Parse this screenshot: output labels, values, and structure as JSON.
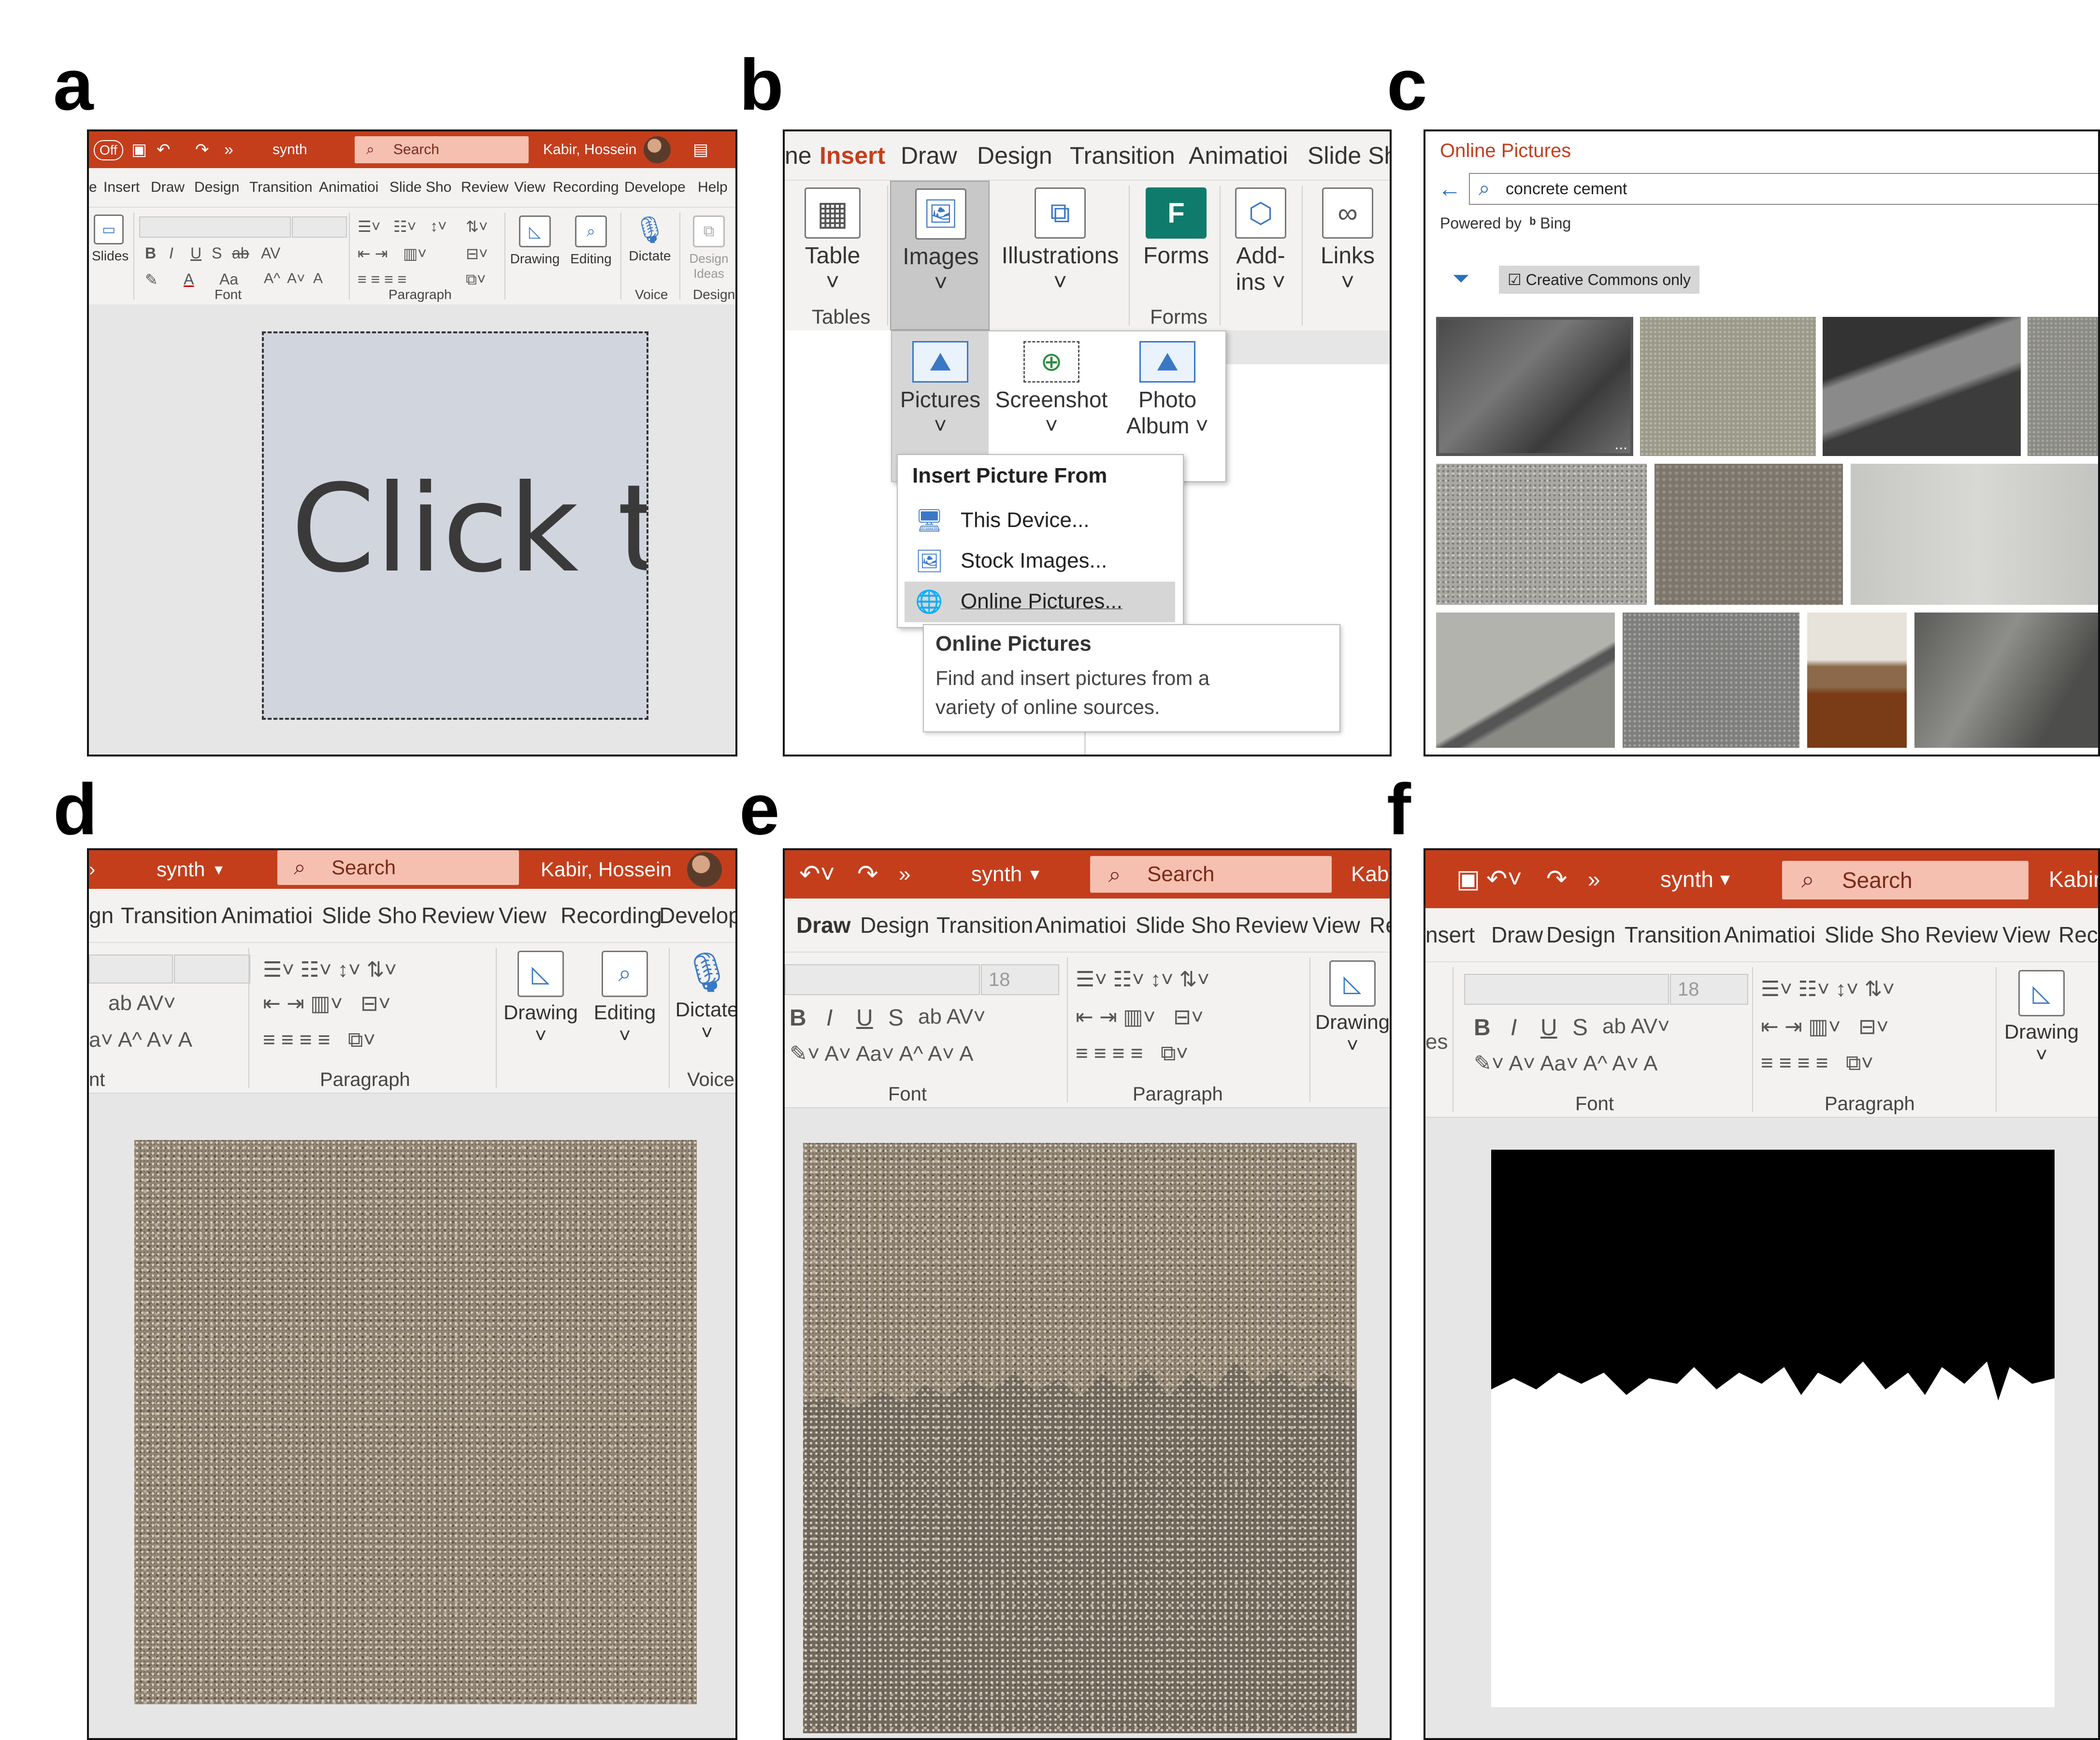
{
  "panel_labels": [
    "a",
    "b",
    "c",
    "d",
    "e",
    "f"
  ],
  "panel_a": {
    "titlebar": {
      "autosave": "Off",
      "more": "»",
      "filename": "synth",
      "search": "Search",
      "user": "Kabir, Hossein"
    },
    "tabs": [
      "e",
      "Insert",
      "Draw",
      "Design",
      "Transition",
      "Animatioi",
      "Slide Sho",
      "Review",
      "View",
      "Recording",
      "Develope",
      "Help"
    ],
    "ribbon": {
      "slides": "Slides",
      "bold": "B",
      "italic": "I",
      "underline": "U",
      "strike": "S",
      "strike_ab": "ab",
      "spacing": "AV",
      "fontcolor": "A",
      "changecase": "Aa",
      "grow": "A^",
      "shrink": "A˅",
      "clear": "A",
      "drawing": "Drawing",
      "editing": "Editing",
      "dictate": "Dictate",
      "designer": "Design Ideas",
      "group_font": "Font",
      "group_paragraph": "Paragraph",
      "group_voice": "Voice",
      "group_designer": "Designe"
    },
    "slide": {
      "placeholder": "Click t"
    }
  },
  "panel_b": {
    "tabs": [
      "ne",
      "Insert",
      "Draw",
      "Design",
      "Transition",
      "Animatioi",
      "Slide Sh"
    ],
    "ribbon": {
      "table": "Table",
      "images": "Images",
      "illustrations": "Illustrations",
      "forms": "Forms",
      "addins_1": "Add-",
      "addins_2": "ins",
      "links": "Links",
      "group_tables": "Tables",
      "group_forms": "Forms"
    },
    "images_menu": {
      "pictures": "Pictures",
      "screenshot": "Screenshot",
      "photo_album_1": "Photo",
      "photo_album_2": "Album"
    },
    "insert_picture": {
      "header": "Insert Picture From",
      "items": [
        "This Device...",
        "Stock Images...",
        "Online Pictures..."
      ]
    },
    "tooltip": {
      "title": "Online Pictures",
      "line1": "Find and insert pictures from a",
      "line2": "variety of online sources."
    }
  },
  "panel_c": {
    "title": "Online Pictures",
    "search_value": "concrete cement",
    "powered_by": "Powered by",
    "bing": "Bing",
    "filter": "Creative Commons only",
    "more_dots": "..."
  },
  "panel_d": {
    "titlebar": {
      "more": "›",
      "filename": "synth",
      "search": "Search",
      "user": "Kabir, Hossein"
    },
    "tabs": [
      "gn",
      "Transition",
      "Animatioi",
      "Slide Sho",
      "Review",
      "View",
      "Recording",
      "Develop"
    ],
    "ribbon": {
      "drawing": "Drawing",
      "editing": "Editing",
      "dictate": "Dictate",
      "group_font": "nt",
      "group_paragraph": "Paragraph",
      "group_voice": "Voice"
    }
  },
  "panel_e": {
    "titlebar": {
      "more": "»",
      "filename": "synth",
      "search": "Search",
      "user": "Kabi"
    },
    "tabs": [
      "Draw",
      "Design",
      "Transition",
      "Animatioi",
      "Slide Sho",
      "Review",
      "View",
      "Re"
    ],
    "ribbon": {
      "font_size": "18",
      "bold": "B",
      "italic": "I",
      "underline": "U",
      "strike": "S",
      "drawing": "Drawing",
      "group_font": "Font",
      "group_paragraph": "Paragraph"
    }
  },
  "panel_f": {
    "titlebar": {
      "more": "»",
      "filename": "synth",
      "search": "Search",
      "user": "Kabir,"
    },
    "tabs": [
      "nsert",
      "Draw",
      "Design",
      "Transition",
      "Animatioi",
      "Slide Sho",
      "Review",
      "View",
      "Rec"
    ],
    "ribbon": {
      "slides": "es",
      "font_size": "18",
      "bold": "B",
      "italic": "I",
      "underline": "U",
      "strike": "S",
      "drawing": "Drawing",
      "group_font": "Font",
      "group_paragraph": "Paragraph"
    }
  },
  "colors": {
    "titlebar": "#c43e1c",
    "search_box": "#f5c0b0",
    "ribbon_bg": "#f3f2f1",
    "accent_red": "#c43e1c",
    "slide_placeholder": "#d1d5de"
  }
}
